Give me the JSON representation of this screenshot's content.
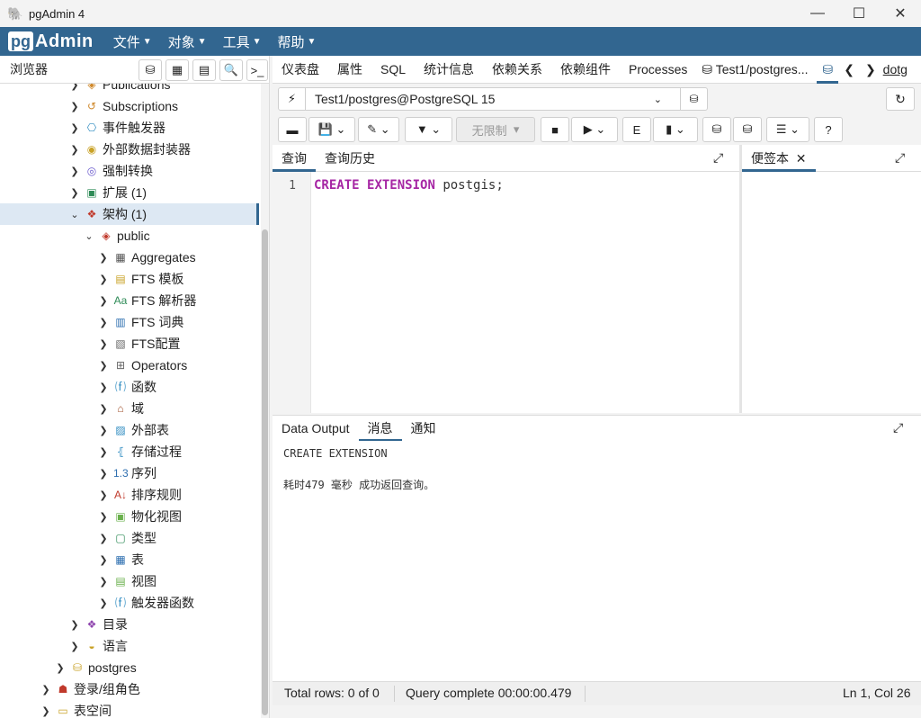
{
  "window": {
    "title": "pgAdmin 4",
    "minimize": "—",
    "maximize": "☐",
    "close": "✕"
  },
  "menubar": {
    "logo_pg": "pg",
    "logo_admin": "Admin",
    "items": [
      "文件",
      "对象",
      "工具",
      "帮助"
    ]
  },
  "browser": {
    "label": "浏览器",
    "tree": [
      {
        "label": "Publications",
        "chevron": "❯",
        "icon": "publication-icon",
        "glyph": "◈",
        "color": "#d08a2e"
      },
      {
        "label": "Subscriptions",
        "chevron": "❯",
        "icon": "subscription-icon",
        "glyph": "↺",
        "color": "#d08a2e"
      },
      {
        "label": "事件触发器",
        "chevron": "❯",
        "icon": "event-trigger-icon",
        "glyph": "⎔",
        "color": "#2e8bc0"
      },
      {
        "label": "外部数据封装器",
        "chevron": "❯",
        "icon": "fdw-icon",
        "glyph": "◉",
        "color": "#c9a227"
      },
      {
        "label": "强制转换",
        "chevron": "❯",
        "icon": "cast-icon",
        "glyph": "◎",
        "color": "#6a5acd"
      },
      {
        "label": "扩展 (1)",
        "chevron": "❯",
        "icon": "extension-icon",
        "glyph": "▣",
        "color": "#2e8b57"
      },
      {
        "label": "架构 (1)",
        "chevron": "⌄",
        "icon": "schema-icon",
        "glyph": "❖",
        "color": "#c0392b"
      },
      {
        "label": "public",
        "chevron": "⌄",
        "icon": "public-schema-icon",
        "glyph": "◈",
        "color": "#c0392b"
      },
      {
        "label": "Aggregates",
        "chevron": "❯",
        "icon": "aggregates-icon",
        "glyph": "▦",
        "color": "#555555"
      },
      {
        "label": "FTS 模板",
        "chevron": "❯",
        "icon": "fts-template-icon",
        "glyph": "▤",
        "color": "#c9a227"
      },
      {
        "label": "FTS 解析器",
        "chevron": "❯",
        "icon": "fts-parser-icon",
        "glyph": "Aa",
        "color": "#2e8b57"
      },
      {
        "label": "FTS 词典",
        "chevron": "❯",
        "icon": "fts-dictionary-icon",
        "glyph": "▥",
        "color": "#2e6fb0"
      },
      {
        "label": "FTS配置",
        "chevron": "❯",
        "icon": "fts-config-icon",
        "glyph": "▧",
        "color": "#666666"
      },
      {
        "label": "Operators",
        "chevron": "❯",
        "icon": "operators-icon",
        "glyph": "⊞",
        "color": "#666666"
      },
      {
        "label": "函数",
        "chevron": "❯",
        "icon": "functions-icon",
        "glyph": "⒡",
        "color": "#2e8bc0"
      },
      {
        "label": "域",
        "chevron": "❯",
        "icon": "domains-icon",
        "glyph": "⌂",
        "color": "#a0522d"
      },
      {
        "label": "外部表",
        "chevron": "❯",
        "icon": "foreign-tables-icon",
        "glyph": "▨",
        "color": "#2e8bc0"
      },
      {
        "label": "存储过程",
        "chevron": "❯",
        "icon": "procedures-icon",
        "glyph": "⦃",
        "color": "#2e8bc0"
      },
      {
        "label": "序列",
        "chevron": "❯",
        "icon": "sequences-icon",
        "glyph": "1.3",
        "color": "#2e6fb0"
      },
      {
        "label": "排序规则",
        "chevron": "❯",
        "icon": "collations-icon",
        "glyph": "A↓",
        "color": "#c0392b"
      },
      {
        "label": "物化视图",
        "chevron": "❯",
        "icon": "materialized-views-icon",
        "glyph": "▣",
        "color": "#6ab04c"
      },
      {
        "label": "类型",
        "chevron": "❯",
        "icon": "types-icon",
        "glyph": "▢",
        "color": "#2e8b57"
      },
      {
        "label": "表",
        "chevron": "❯",
        "icon": "tables-icon",
        "glyph": "▦",
        "color": "#2e6fb0"
      },
      {
        "label": "视图",
        "chevron": "❯",
        "icon": "views-icon",
        "glyph": "▤",
        "color": "#6ab04c"
      },
      {
        "label": "触发器函数",
        "chevron": "❯",
        "icon": "trigger-functions-icon",
        "glyph": "⒡",
        "color": "#2e8bc0"
      },
      {
        "label": "目录",
        "chevron": "❯",
        "icon": "catalogs-icon",
        "glyph": "❖",
        "color": "#8e44ad"
      },
      {
        "label": "语言",
        "chevron": "❯",
        "icon": "languages-icon",
        "glyph": "◒",
        "color": "#c9a227"
      },
      {
        "label": "postgres",
        "chevron": "❯",
        "icon": "database-icon",
        "glyph": "⛁",
        "color": "#c9a227"
      },
      {
        "label": "登录/组角色",
        "chevron": "❯",
        "icon": "login-roles-icon",
        "glyph": "☗",
        "color": "#c0392b"
      },
      {
        "label": "表空间",
        "chevron": "❯",
        "icon": "tablespaces-icon",
        "glyph": "▭",
        "color": "#c9a227"
      }
    ]
  },
  "tabs": [
    "仪表盘",
    "属性",
    "SQL",
    "统计信息",
    "依赖关系",
    "依赖组件",
    "Processes",
    "Test1/postgres...",
    "dotg"
  ],
  "query_tool": {
    "connection": "Test1/postgres@PostgreSQL 15",
    "limit_label": "无限制",
    "editor_tabs": [
      "查询",
      "查询历史"
    ],
    "scratch_tab": "便签本",
    "line_number": "1",
    "code": {
      "kw1": "CREATE",
      "kw2": "EXTENSION",
      "ident": "postgis;"
    }
  },
  "output": {
    "tabs": [
      "Data Output",
      "消息",
      "通知"
    ],
    "message_line1": "CREATE EXTENSION",
    "message_line2": "耗时479 毫秒 成功返回查询。"
  },
  "status": {
    "total_rows": "Total rows: 0 of 0",
    "query_complete": "Query complete 00:00:00.479",
    "cursor": "Ln 1, Col 26"
  },
  "colors": {
    "brand": "#326690",
    "keyword": "#a626a4"
  }
}
